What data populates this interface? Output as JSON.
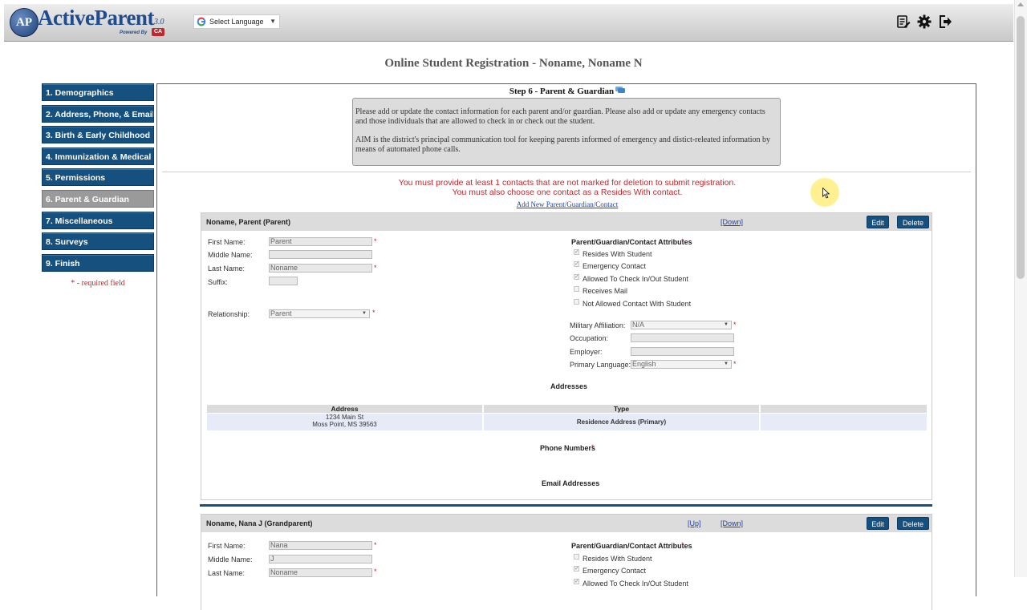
{
  "header": {
    "logo_letters": "AP",
    "logo_text": "ActiveParent",
    "version": "3.0",
    "powered_by": "Powered By",
    "brand_badge": "CA",
    "language_select": "Select Language",
    "icons": [
      "edit-list-icon",
      "gear-icon",
      "logout-icon"
    ]
  },
  "page_title": "Online Student Registration - Noname, Noname N",
  "nav": {
    "items": [
      {
        "label": "1. Demographics"
      },
      {
        "label": "2. Address, Phone, & Email"
      },
      {
        "label": "3. Birth & Early Childhood"
      },
      {
        "label": "4. Immunization & Medical"
      },
      {
        "label": "5. Permissions"
      },
      {
        "label": "6. Parent & Guardian"
      },
      {
        "label": "7. Miscellaneous"
      },
      {
        "label": "8. Surveys"
      },
      {
        "label": "9. Finish"
      }
    ],
    "active_index": 5,
    "required_note": "* - required field"
  },
  "step": {
    "title": "Step 6 - Parent & Guardian",
    "info_p1": "Please add or update the contact information for each parent and/or guardian. Please also add or update any emergency contacts and those individuals that are allowed to check in or check out the student.",
    "info_p2": "AIM is the district's principal communication tool for keeping parents informed of emergency and distict-releated information by means of automated phone calls.",
    "warning_1": "You must provide at least 1 contacts that are not marked for deletion to submit registration.",
    "warning_2": "You must also choose one contact as a Resides With contact.",
    "add_link": "Add New Parent/Guardian/Contact"
  },
  "labels": {
    "first_name": "First Name:",
    "middle_name": "Middle Name:",
    "last_name": "Last Name:",
    "suffix": "Suffix:",
    "relationship": "Relationship:",
    "attributes_title": "Parent/Guardian/Contact Attributes",
    "military": "Military Affiliation:",
    "occupation": "Occupation:",
    "employer": "Employer:",
    "primary_language": "Primary Language:",
    "addresses": "Addresses",
    "address_col": "Address",
    "type_col": "Type",
    "phone_numbers": "Phone Numbers",
    "email_addresses": "Email Addresses",
    "up": "[Up]",
    "down": "[Down]",
    "edit": "Edit",
    "delete": "Delete",
    "star": "*"
  },
  "contacts": [
    {
      "header": "Noname, Parent (Parent)",
      "first_name": "Parent",
      "middle_name": "",
      "last_name": "Noname",
      "suffix": "",
      "relationship": "Parent",
      "attributes": [
        {
          "label": "Resides With Student",
          "checked": true
        },
        {
          "label": "Emergency Contact",
          "checked": true
        },
        {
          "label": "Allowed To Check In/Out Student",
          "checked": true
        },
        {
          "label": "Receives Mail",
          "checked": false
        },
        {
          "label": "Not Allowed Contact With Student",
          "checked": false
        }
      ],
      "military": "N/A",
      "occupation": "",
      "employer": "",
      "primary_language": "English",
      "address_line1": "1234 Main St",
      "address_line2": "Moss Point, MS 39563",
      "address_type": "Residence Address (Primary)"
    },
    {
      "header": "Noname, Nana J (Grandparent)",
      "first_name": "Nana",
      "middle_name": "J",
      "last_name": "Noname",
      "attributes": [
        {
          "label": "Resides With Student",
          "checked": false
        },
        {
          "label": "Emergency Contact",
          "checked": true
        },
        {
          "label": "Allowed To Check In/Out Student",
          "checked": true
        }
      ]
    }
  ]
}
